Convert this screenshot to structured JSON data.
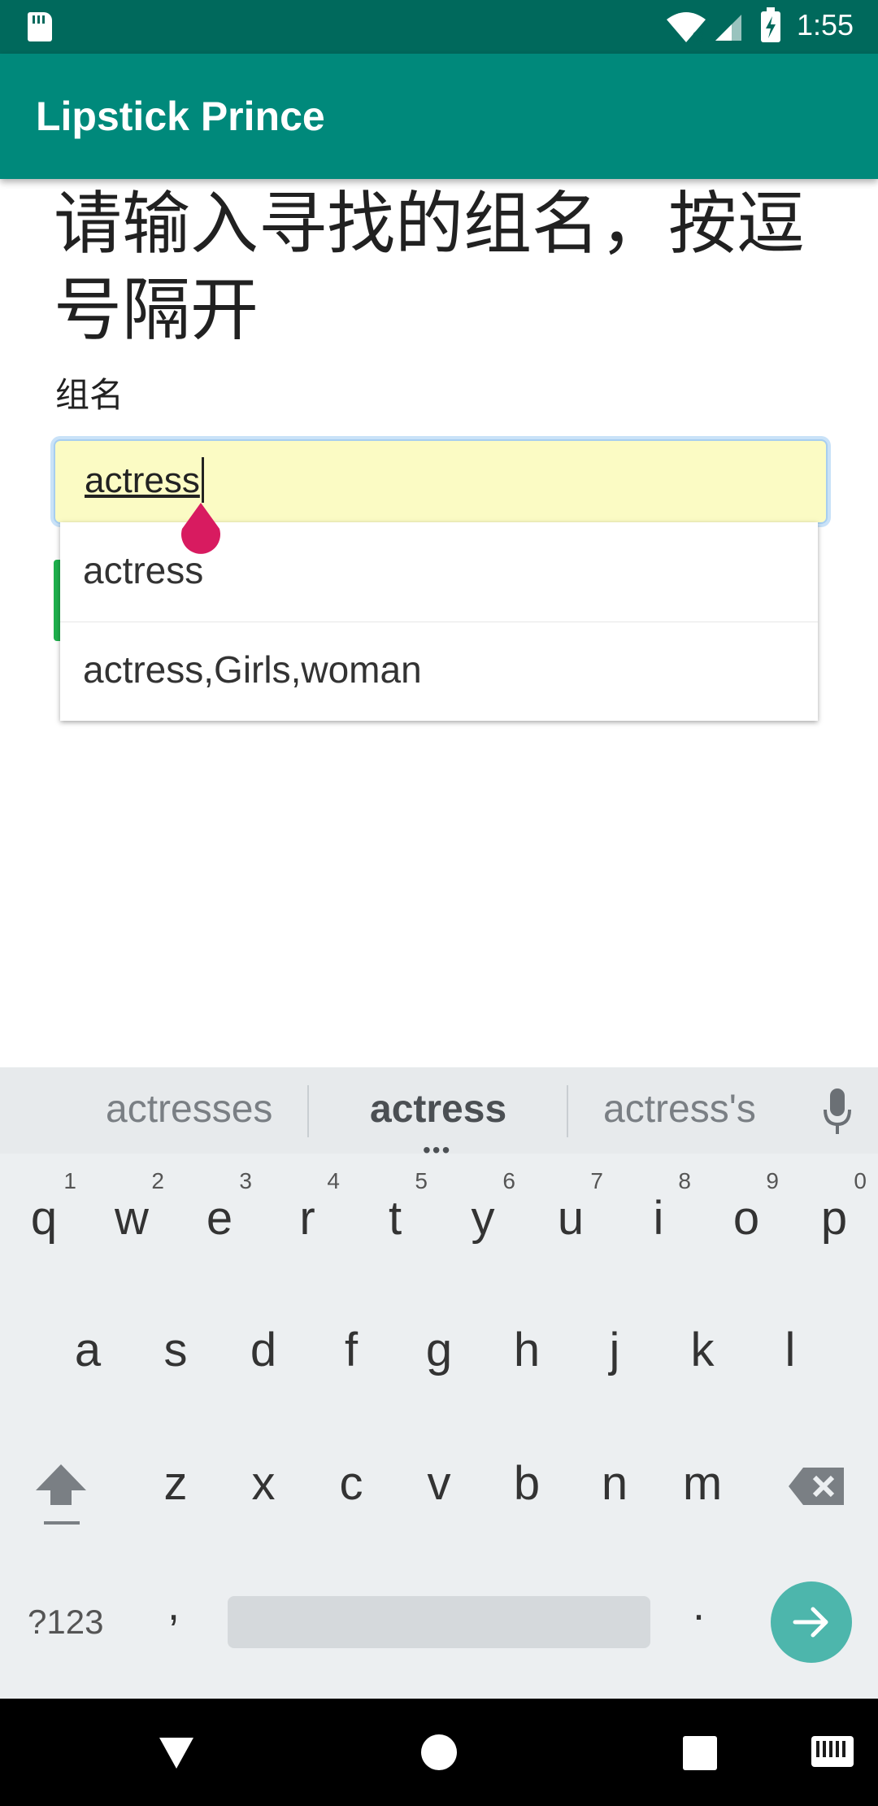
{
  "status_bar": {
    "time": "1:55"
  },
  "app_bar": {
    "title": "Lipstick Prince"
  },
  "main": {
    "heading": "请输入寻找的组名，按逗号隔开",
    "field_label": "组名",
    "input_value": "actress"
  },
  "dropdown": {
    "items": [
      "actress",
      "actress,Girls,woman"
    ]
  },
  "keyboard": {
    "suggestions": [
      "actresses",
      "actress",
      "actress's"
    ],
    "row1": [
      {
        "key": "q",
        "hint": "1"
      },
      {
        "key": "w",
        "hint": "2"
      },
      {
        "key": "e",
        "hint": "3"
      },
      {
        "key": "r",
        "hint": "4"
      },
      {
        "key": "t",
        "hint": "5"
      },
      {
        "key": "y",
        "hint": "6"
      },
      {
        "key": "u",
        "hint": "7"
      },
      {
        "key": "i",
        "hint": "8"
      },
      {
        "key": "o",
        "hint": "9"
      },
      {
        "key": "p",
        "hint": "0"
      }
    ],
    "row2": [
      "a",
      "s",
      "d",
      "f",
      "g",
      "h",
      "j",
      "k",
      "l"
    ],
    "row3": [
      "z",
      "x",
      "c",
      "v",
      "b",
      "n",
      "m"
    ],
    "symbols_label": "?123",
    "comma": ",",
    "period": "."
  },
  "colors": {
    "status_bar": "#00695c",
    "app_bar": "#00897b",
    "input_bg": "#fbfbc4",
    "handle": "#d81b60",
    "enter_key": "#4db6ac"
  },
  "icons": [
    "sd-card-icon",
    "wifi-icon",
    "cell-signal-icon",
    "battery-charging-icon",
    "mic-icon",
    "shift-icon",
    "backspace-icon",
    "arrow-right-icon",
    "nav-back-icon",
    "nav-home-icon",
    "nav-recent-icon",
    "keyboard-icon"
  ]
}
